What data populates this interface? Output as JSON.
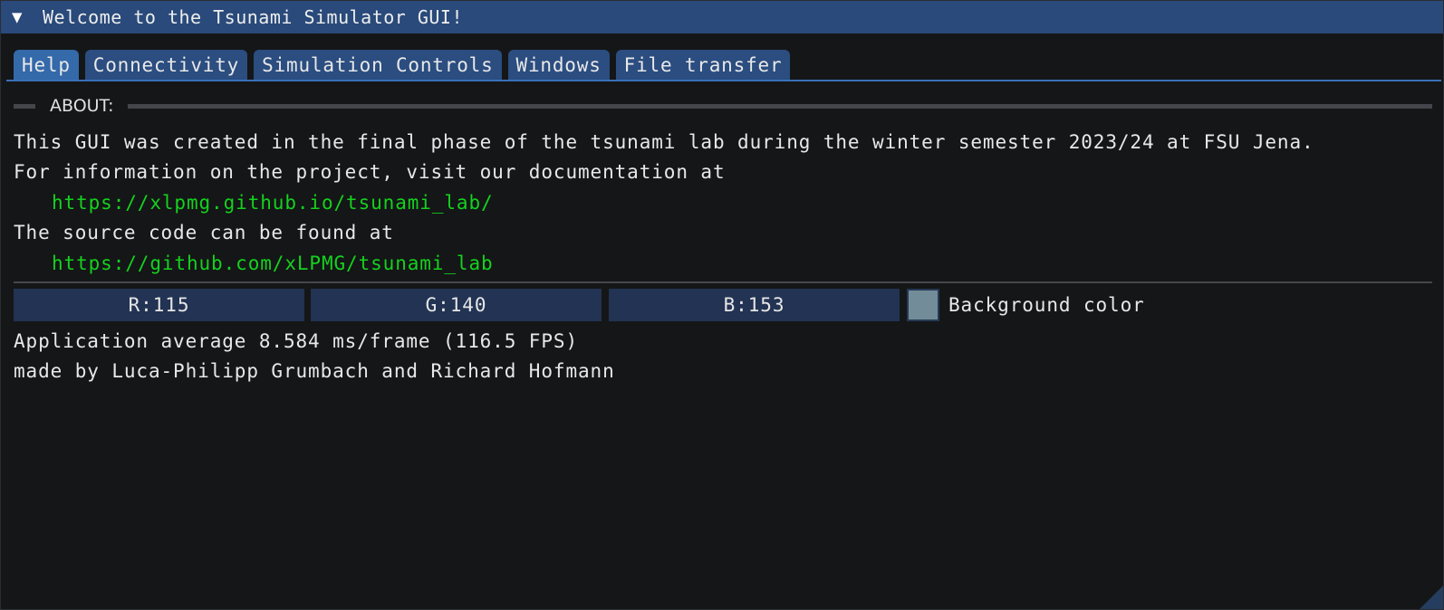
{
  "window": {
    "title": "Welcome to the Tsunami Simulator GUI!",
    "collapse_glyph": "▼"
  },
  "tabs": [
    {
      "label": "Help",
      "active": true
    },
    {
      "label": "Connectivity",
      "active": false
    },
    {
      "label": "Simulation Controls",
      "active": false
    },
    {
      "label": "Windows",
      "active": false
    },
    {
      "label": "File transfer",
      "active": false
    }
  ],
  "help": {
    "section_label": "ABOUT:",
    "line1": "This GUI was created in the final phase of the tsunami lab during the winter semester 2023/24 at FSU Jena.",
    "line2": "For information on the project, visit our documentation at",
    "docs_link": "https://xlpmg.github.io/tsunami_lab/",
    "line3": "The source code can be found at",
    "source_link": "https://github.com/xLPMG/tsunami_lab",
    "background_color": {
      "r_label": "R:115",
      "g_label": "G:140",
      "b_label": "B:153",
      "r": 115,
      "g": 140,
      "b": 153,
      "swatch_hex": "#738c99",
      "label": "Background color"
    },
    "perf": "Application average 8.584 ms/frame (116.5 FPS)",
    "credits": "made by Luca-Philipp Grumbach and Richard Hofmann"
  },
  "colors": {
    "titlebar": "#294a7a",
    "tab": "#2b4d80",
    "tab_active": "#3469aa",
    "link": "#14d21e",
    "background": "#151617"
  }
}
